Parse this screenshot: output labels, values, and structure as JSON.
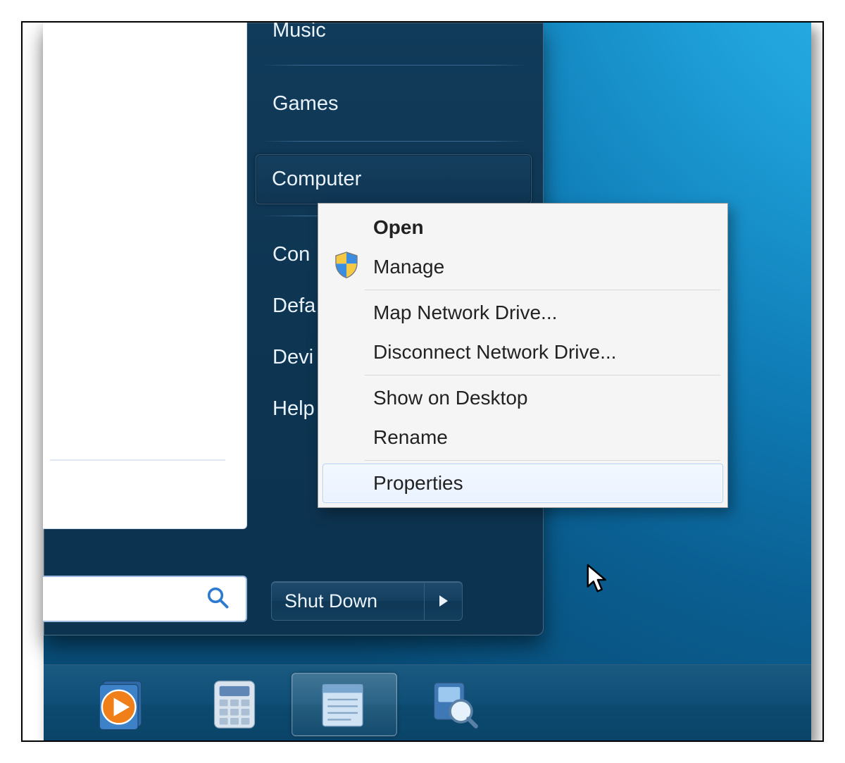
{
  "startmenu": {
    "right_items": [
      {
        "label": "Music",
        "cut": true
      },
      {
        "label": "Games",
        "divider_before": true
      },
      {
        "label": "Computer",
        "highlight": true,
        "divider_before": true
      },
      {
        "label": "Con",
        "divider_before": true,
        "full": "Control Panel"
      },
      {
        "label": "Defa",
        "full": "Default Programs"
      },
      {
        "label": "Devi",
        "full": "Devices and Printers"
      },
      {
        "label": "Help",
        "full": "Help and Support"
      }
    ],
    "shutdown_label": "Shut Down"
  },
  "context_menu": {
    "items": [
      {
        "label": "Open",
        "bold": true
      },
      {
        "label": "Manage",
        "shield": true
      },
      {
        "separator": true
      },
      {
        "label": "Map Network Drive..."
      },
      {
        "label": "Disconnect Network Drive..."
      },
      {
        "separator": true
      },
      {
        "label": "Show on Desktop"
      },
      {
        "label": "Rename"
      },
      {
        "separator": true
      },
      {
        "label": "Properties",
        "hover": true
      }
    ]
  },
  "taskbar": {
    "items": [
      {
        "name": "media-player",
        "active": false
      },
      {
        "name": "calculator",
        "active": false
      },
      {
        "name": "notepad",
        "active": true
      },
      {
        "name": "magnifier",
        "active": false
      }
    ]
  }
}
